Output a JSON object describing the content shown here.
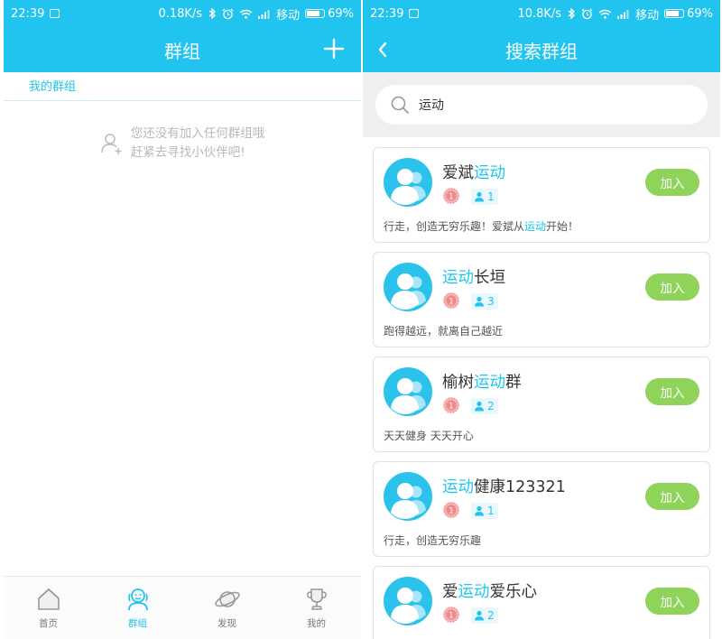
{
  "status_left": {
    "time": "22:39",
    "speed": "0.18K/s",
    "carrier": "移动",
    "battery": "69%"
  },
  "status_right": {
    "time": "22:39",
    "speed": "10.8K/s",
    "carrier": "移动",
    "battery": "69%"
  },
  "groups_screen": {
    "title": "群组",
    "section_label": "我的群组",
    "empty_line1": "您还没有加入任何群组哦",
    "empty_line2": "赶紧去寻找小伙伴吧!"
  },
  "tabbar": {
    "items": [
      {
        "label": "首页",
        "icon": "home-icon",
        "active": false
      },
      {
        "label": "群组",
        "icon": "group-icon",
        "active": true
      },
      {
        "label": "发现",
        "icon": "planet-icon",
        "active": false
      },
      {
        "label": "我的",
        "icon": "trophy-icon",
        "active": false
      }
    ]
  },
  "search_screen": {
    "title": "搜索群组",
    "query": "运动",
    "join_label": "加入",
    "results": [
      {
        "name_pre": "爱斌",
        "name_hl": "运动",
        "name_post": "",
        "level": "1",
        "members": "1",
        "desc_pre": "行走，创造无穷乐趣！爱斌从",
        "desc_hl": "运动",
        "desc_post": "开始！"
      },
      {
        "name_pre": "",
        "name_hl": "运动",
        "name_post": "长垣",
        "level": "1",
        "members": "3",
        "desc_pre": "跑得越远，就离自己越近",
        "desc_hl": "",
        "desc_post": ""
      },
      {
        "name_pre": "榆树",
        "name_hl": "运动",
        "name_post": "群",
        "level": "1",
        "members": "2",
        "desc_pre": "天天健身 天天开心",
        "desc_hl": "",
        "desc_post": ""
      },
      {
        "name_pre": "",
        "name_hl": "运动",
        "name_post": "健康123321",
        "level": "1",
        "members": "1",
        "desc_pre": "行走，创造无穷乐趣",
        "desc_hl": "",
        "desc_post": ""
      },
      {
        "name_pre": "爱",
        "name_hl": "运动",
        "name_post": "爱乐心",
        "level": "1",
        "members": "2",
        "desc_pre": "",
        "desc_hl": "",
        "desc_post": ""
      }
    ]
  },
  "colors": {
    "primary": "#20c4ee",
    "join_button": "#8fd35a",
    "badge": "#f08a8a"
  }
}
